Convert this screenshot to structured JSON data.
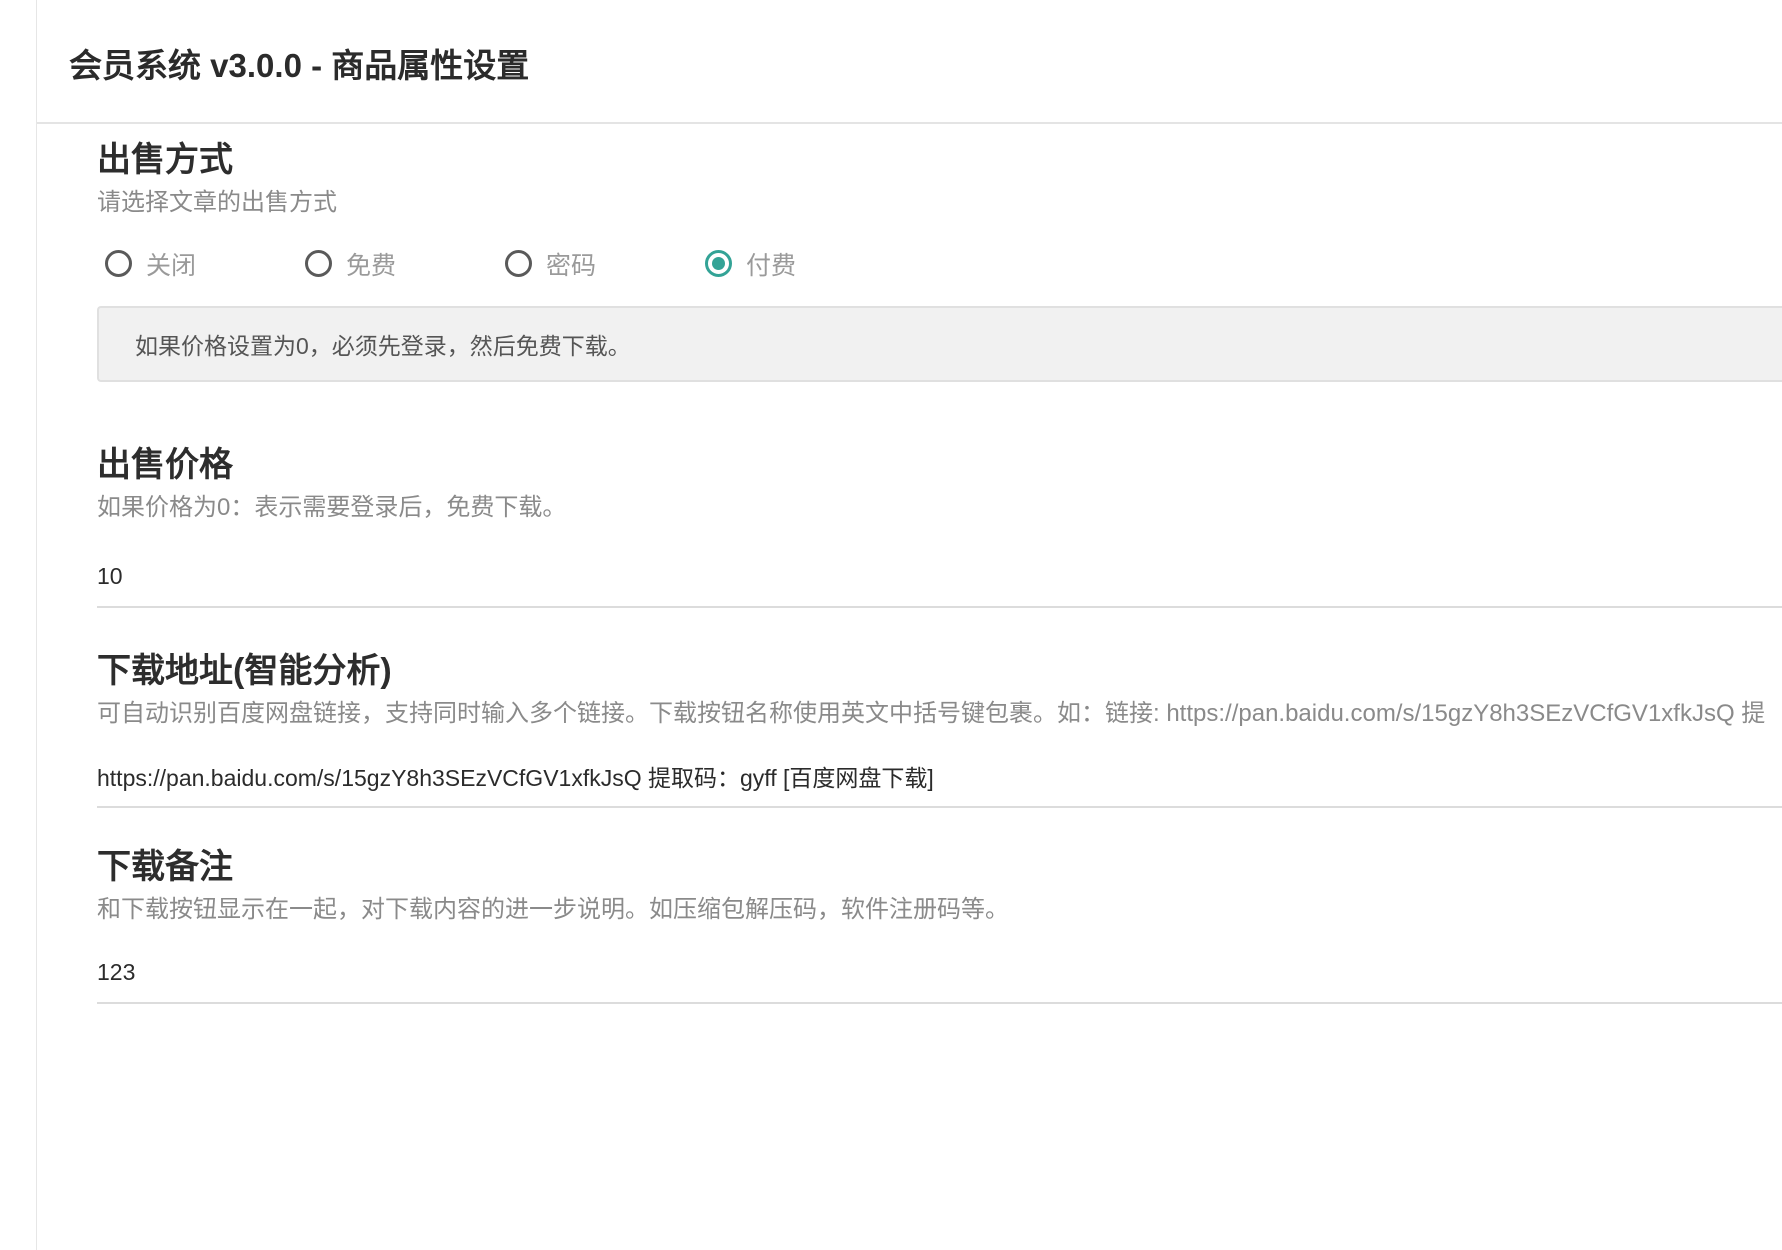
{
  "header": {
    "title": "会员系统 v3.0.0 - 商品属性设置"
  },
  "sale_method": {
    "title": "出售方式",
    "description": "请选择文章的出售方式",
    "options": [
      {
        "label": "关闭",
        "checked": false
      },
      {
        "label": "免费",
        "checked": false
      },
      {
        "label": "密码",
        "checked": false
      },
      {
        "label": "付费",
        "checked": true
      }
    ],
    "notice": "如果价格设置为0，必须先登录，然后免费下载。"
  },
  "sale_price": {
    "title": "出售价格",
    "description": "如果价格为0：表示需要登录后，免费下载。",
    "value": "10"
  },
  "download_url": {
    "title": "下载地址(智能分析)",
    "description": "可自动识别百度网盘链接，支持同时输入多个链接。下载按钮名称使用英文中括号键包裹。如：链接: https://pan.baidu.com/s/15gzY8h3SEzVCfGV1xfkJsQ 提",
    "value": "https://pan.baidu.com/s/15gzY8h3SEzVCfGV1xfkJsQ 提取码：gyff [百度网盘下载]"
  },
  "download_note": {
    "title": "下载备注",
    "description": "和下载按钮显示在一起，对下载内容的进一步说明。如压缩包解压码，软件注册码等。",
    "value": "123"
  },
  "colors": {
    "accent": "#33a396",
    "notice_bg": "#f1f1f1"
  }
}
